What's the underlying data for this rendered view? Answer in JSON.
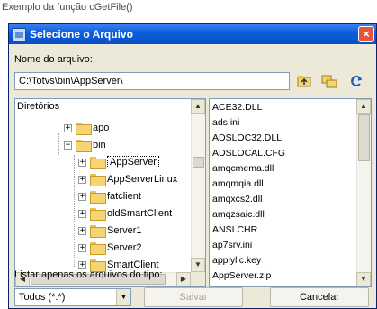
{
  "caption": "Exemplo da função cGetFile()",
  "dialog": {
    "title": "Selecione o Arquivo",
    "close_label": "×"
  },
  "path": {
    "label": "Nome do arquivo:",
    "value": "C:\\Totvs\\bin\\AppServer\\"
  },
  "toolbar": {
    "icons": [
      "folder-up-icon",
      "folders-icon",
      "refresh-icon"
    ]
  },
  "tree": {
    "header": "Diretórios",
    "items": [
      {
        "label": "apo",
        "expander": "+"
      },
      {
        "label": "bin",
        "expander": "−"
      },
      {
        "label": "AppServer",
        "expander": "+",
        "selected": true
      },
      {
        "label": "AppServerLinux",
        "expander": "+"
      },
      {
        "label": "fatclient",
        "expander": "+"
      },
      {
        "label": "oldSmartClient",
        "expander": "+"
      },
      {
        "label": "Server1",
        "expander": "+"
      },
      {
        "label": "Server2",
        "expander": "+"
      },
      {
        "label": "SmartClient",
        "expander": "+"
      }
    ]
  },
  "files": {
    "items": [
      "ACE32.DLL",
      "ads.ini",
      "ADSLOC32.DLL",
      "ADSLOCAL.CFG",
      "amqcmema.dll",
      "amqmqia.dll",
      "amqxcs2.dll",
      "amqzsaic.dll",
      "ANSI.CHR",
      "ap7srv.ini",
      "applylic.key",
      "AppServer.zip"
    ]
  },
  "filter": {
    "label": "Listar apenas os arquivos do tipo:",
    "value": "Todos (*.*)"
  },
  "buttons": {
    "save": "Salvar",
    "cancel": "Cancelar"
  }
}
